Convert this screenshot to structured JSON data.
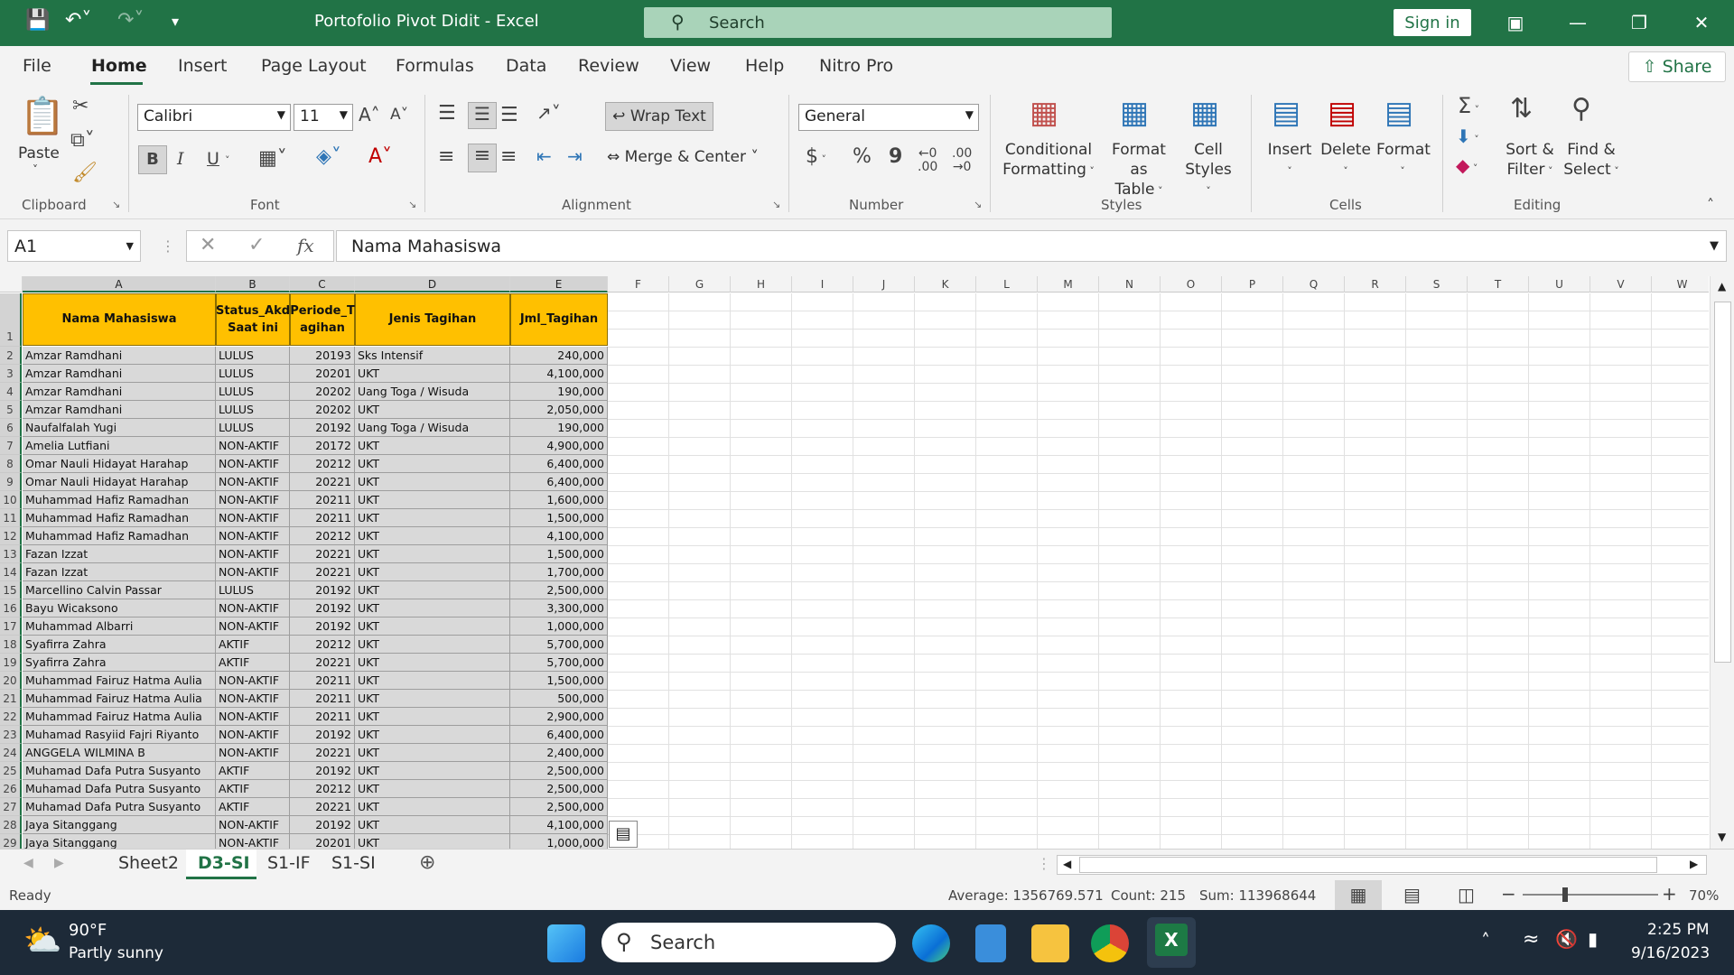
{
  "window": {
    "title": "Portofolio Pivot Didit  -  Excel",
    "search_placeholder": "Search",
    "sign_in": "Sign in"
  },
  "tabs": [
    "File",
    "Home",
    "Insert",
    "Page Layout",
    "Formulas",
    "Data",
    "Review",
    "View",
    "Help",
    "Nitro Pro"
  ],
  "share_label": "Share",
  "ribbon": {
    "clipboard": {
      "label": "Clipboard",
      "paste": "Paste"
    },
    "font": {
      "label": "Font",
      "name": "Calibri",
      "size": "11",
      "bold": "B",
      "italic": "I",
      "underline": "U"
    },
    "alignment": {
      "label": "Alignment",
      "wrap": "Wrap Text",
      "merge": "Merge & Center"
    },
    "number": {
      "label": "Number",
      "format": "General",
      "currency": "$",
      "percent": "%",
      "comma": "9"
    },
    "styles": {
      "label": "Styles",
      "conditional": "Conditional",
      "conditional2": "Formatting",
      "format_table": "Format as",
      "format_table2": "Table",
      "cell_styles": "Cell",
      "cell_styles2": "Styles"
    },
    "cells": {
      "label": "Cells",
      "insert": "Insert",
      "delete": "Delete",
      "format": "Format"
    },
    "editing": {
      "label": "Editing",
      "sort": "Sort &",
      "sort2": "Filter",
      "find": "Find &",
      "find2": "Select"
    }
  },
  "formula_bar": {
    "name_box": "A1",
    "fx": "fx",
    "value": "Nama Mahasiswa"
  },
  "columns": [
    "A",
    "B",
    "C",
    "D",
    "E",
    "F",
    "G",
    "H",
    "I",
    "J",
    "K",
    "L",
    "M",
    "N",
    "O",
    "P",
    "Q",
    "R",
    "S",
    "T",
    "U",
    "V",
    "W"
  ],
  "table": {
    "headers": {
      "a": "Nama Mahasiswa",
      "b1": "Status_Akd",
      "b2": "Saat ini",
      "c1": "Periode_T",
      "c2": "agihan",
      "d": "Jenis Tagihan",
      "e": "Jml_Tagihan"
    },
    "rows": [
      [
        "Amzar Ramdhani",
        "LULUS",
        "20193",
        "Sks Intensif",
        "240,000"
      ],
      [
        "Amzar Ramdhani",
        "LULUS",
        "20201",
        "UKT",
        "4,100,000"
      ],
      [
        "Amzar Ramdhani",
        "LULUS",
        "20202",
        "Uang Toga / Wisuda",
        "190,000"
      ],
      [
        "Amzar Ramdhani",
        "LULUS",
        "20202",
        "UKT",
        "2,050,000"
      ],
      [
        "Naufalfalah Yugi",
        "LULUS",
        "20192",
        "Uang Toga / Wisuda",
        "190,000"
      ],
      [
        "Amelia Lutfiani",
        "NON-AKTIF",
        "20172",
        "UKT",
        "4,900,000"
      ],
      [
        "Omar Nauli Hidayat Harahap",
        "NON-AKTIF",
        "20212",
        "UKT",
        "6,400,000"
      ],
      [
        "Omar Nauli Hidayat Harahap",
        "NON-AKTIF",
        "20221",
        "UKT",
        "6,400,000"
      ],
      [
        "Muhammad Hafiz Ramadhan",
        "NON-AKTIF",
        "20211",
        "UKT",
        "1,600,000"
      ],
      [
        "Muhammad Hafiz Ramadhan",
        "NON-AKTIF",
        "20211",
        "UKT",
        "1,500,000"
      ],
      [
        "Muhammad Hafiz Ramadhan",
        "NON-AKTIF",
        "20212",
        "UKT",
        "4,100,000"
      ],
      [
        "Fazan Izzat",
        "NON-AKTIF",
        "20221",
        "UKT",
        "1,500,000"
      ],
      [
        "Fazan Izzat",
        "NON-AKTIF",
        "20221",
        "UKT",
        "1,700,000"
      ],
      [
        "Marcellino Calvin Passar",
        "LULUS",
        "20192",
        "UKT",
        "2,500,000"
      ],
      [
        "Bayu Wicaksono",
        "NON-AKTIF",
        "20192",
        "UKT",
        "3,300,000"
      ],
      [
        "Muhammad Albarri",
        "NON-AKTIF",
        "20192",
        "UKT",
        "1,000,000"
      ],
      [
        "Syafirra Zahra",
        "AKTIF",
        "20212",
        "UKT",
        "5,700,000"
      ],
      [
        "Syafirra Zahra",
        "AKTIF",
        "20221",
        "UKT",
        "5,700,000"
      ],
      [
        "Muhammad Fairuz Hatma Aulia",
        "NON-AKTIF",
        "20211",
        "UKT",
        "1,500,000"
      ],
      [
        "Muhammad Fairuz Hatma Aulia",
        "NON-AKTIF",
        "20211",
        "UKT",
        "500,000"
      ],
      [
        "Muhammad Fairuz Hatma Aulia",
        "NON-AKTIF",
        "20211",
        "UKT",
        "2,900,000"
      ],
      [
        "Muhamad Rasyiid Fajri Riyanto",
        "NON-AKTIF",
        "20192",
        "UKT",
        "6,400,000"
      ],
      [
        "ANGGELA WILMINA B",
        "NON-AKTIF",
        "20221",
        "UKT",
        "2,400,000"
      ],
      [
        "Muhamad Dafa Putra Susyanto",
        "AKTIF",
        "20192",
        "UKT",
        "2,500,000"
      ],
      [
        "Muhamad Dafa Putra Susyanto",
        "AKTIF",
        "20212",
        "UKT",
        "2,500,000"
      ],
      [
        "Muhamad Dafa Putra Susyanto",
        "AKTIF",
        "20221",
        "UKT",
        "2,500,000"
      ],
      [
        "Jaya Sitanggang",
        "NON-AKTIF",
        "20192",
        "UKT",
        "4,100,000"
      ],
      [
        "Jaya Sitanggang",
        "NON-AKTIF",
        "20201",
        "UKT",
        "1,000,000"
      ]
    ]
  },
  "sheets": [
    "Sheet2",
    "D3-SI",
    "S1-IF",
    "S1-SI"
  ],
  "status": {
    "ready": "Ready",
    "average": "Average: 1356769.571",
    "count": "Count: 215",
    "sum": "Sum: 113968644",
    "zoom": "70%"
  },
  "taskbar": {
    "temp": "90°F",
    "weather": "Partly sunny",
    "search": "Search",
    "time": "2:25 PM",
    "date": "9/16/2023"
  },
  "colors": {
    "excel_green": "#217346",
    "header_fill": "#ffc000",
    "selection_fill": "#d9d9d9"
  }
}
